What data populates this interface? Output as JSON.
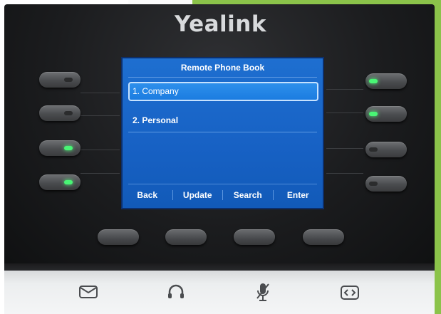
{
  "device": {
    "brand": "Yealink"
  },
  "screen": {
    "title": "Remote Phone Book",
    "items": [
      {
        "label": "1. Company",
        "selected": true
      },
      {
        "label": "2. Personal",
        "selected": false
      }
    ],
    "softkeys": [
      "Back",
      "Update",
      "Search",
      "Enter"
    ]
  },
  "line_keys": {
    "left_led_on": [
      false,
      false,
      true,
      true
    ],
    "right_led_on": [
      true,
      true,
      false,
      false
    ]
  },
  "function_keys": [
    {
      "icon": "mail-icon"
    },
    {
      "icon": "headset-icon"
    },
    {
      "icon": "mute-microphone-icon"
    },
    {
      "icon": "transfer-icon"
    }
  ],
  "colors": {
    "screen_blue": "#1761c4",
    "led_green": "#49f575",
    "brand_text": "#d8dadc",
    "background_green": "#8bc34a"
  }
}
